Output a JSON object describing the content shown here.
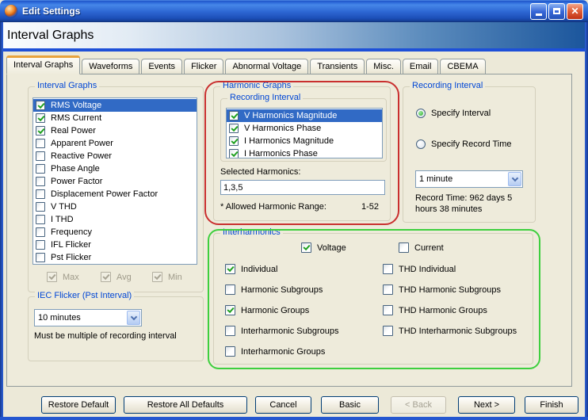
{
  "colors": {
    "outline-red": "#c92f2f",
    "outline-green": "#3ecf3e",
    "selection-blue": "#316ac5",
    "caption-blue": "#0046d5",
    "active-tab-accent": "#e8a33d",
    "check-green": "#21a121"
  },
  "titlebar": {
    "title": "Edit Settings"
  },
  "header": {
    "title": "Interval Graphs"
  },
  "tabs": [
    "Interval Graphs",
    "Waveforms",
    "Events",
    "Flicker",
    "Abnormal Voltage",
    "Transients",
    "Misc.",
    "Email",
    "CBEMA"
  ],
  "active_tab": "Interval Graphs",
  "interval_graphs": {
    "caption": "Interval Graphs",
    "items": [
      {
        "label": "RMS Voltage",
        "checked": true,
        "selected": true
      },
      {
        "label": "RMS Current",
        "checked": true,
        "selected": false
      },
      {
        "label": "Real Power",
        "checked": true,
        "selected": false
      },
      {
        "label": "Apparent Power",
        "checked": false,
        "selected": false
      },
      {
        "label": "Reactive Power",
        "checked": false,
        "selected": false
      },
      {
        "label": "Phase Angle",
        "checked": false,
        "selected": false
      },
      {
        "label": "Power Factor",
        "checked": false,
        "selected": false
      },
      {
        "label": "Displacement Power Factor",
        "checked": false,
        "selected": false
      },
      {
        "label": "V THD",
        "checked": false,
        "selected": false
      },
      {
        "label": "I THD",
        "checked": false,
        "selected": false
      },
      {
        "label": "Frequency",
        "checked": false,
        "selected": false
      },
      {
        "label": "IFL Flicker",
        "checked": false,
        "selected": false
      },
      {
        "label": "Pst Flicker",
        "checked": false,
        "selected": false
      }
    ],
    "stats": [
      {
        "label": "Max",
        "checked": true,
        "disabled": true
      },
      {
        "label": "Avg",
        "checked": true,
        "disabled": true
      },
      {
        "label": "Min",
        "checked": true,
        "disabled": true
      }
    ]
  },
  "iec_flicker": {
    "caption": "IEC Flicker (Pst Interval)",
    "value": "10 minutes",
    "note": "Must be multiple of recording interval"
  },
  "harmonic_graphs": {
    "caption": "Harmonic Graphs",
    "recording_interval": {
      "caption": "Recording Interval",
      "items": [
        {
          "label": "V Harmonics Magnitude",
          "checked": true,
          "selected": true
        },
        {
          "label": "V Harmonics Phase",
          "checked": true,
          "selected": false
        },
        {
          "label": "I Harmonics Magnitude",
          "checked": true,
          "selected": false
        },
        {
          "label": "I Harmonics Phase",
          "checked": true,
          "selected": false
        }
      ]
    },
    "selected_harmonics_label": "Selected Harmonics:",
    "selected_harmonics_value": "1,3,5",
    "allowed_range_label": "* Allowed Harmonic Range:",
    "allowed_range_value": "1-52"
  },
  "recording_interval": {
    "caption": "Recording Interval",
    "options": [
      {
        "label": "Specify Interval",
        "selected": true
      },
      {
        "label": "Specify Record Time",
        "selected": false
      }
    ],
    "interval_value": "1 minute",
    "record_time_note": "Record Time: 962 days 5 hours 38 minutes"
  },
  "interharmonics": {
    "caption": "Interharmonics",
    "type_checks": [
      {
        "label": "Voltage",
        "checked": true
      },
      {
        "label": "Current",
        "checked": false
      }
    ],
    "left_checks": [
      {
        "label": "Individual",
        "checked": true
      },
      {
        "label": "Harmonic Subgroups",
        "checked": false
      },
      {
        "label": "Harmonic Groups",
        "checked": true
      },
      {
        "label": "Interharmonic Subgroups",
        "checked": false
      },
      {
        "label": "Interharmonic Groups",
        "checked": false
      }
    ],
    "right_checks": [
      {
        "label": "THD Individual",
        "checked": false
      },
      {
        "label": "THD Harmonic Subgroups",
        "checked": false
      },
      {
        "label": "THD Harmonic Groups",
        "checked": false
      },
      {
        "label": "THD Interharmonic Subgroups",
        "checked": false
      }
    ]
  },
  "footer_buttons": [
    {
      "label": "Restore Default",
      "disabled": false
    },
    {
      "label": "Restore All Defaults",
      "disabled": false
    },
    {
      "label": "Cancel",
      "disabled": false
    },
    {
      "label": "Basic",
      "disabled": false
    },
    {
      "label": "< Back",
      "disabled": true
    },
    {
      "label": "Next >",
      "disabled": false
    },
    {
      "label": "Finish",
      "disabled": false
    }
  ]
}
